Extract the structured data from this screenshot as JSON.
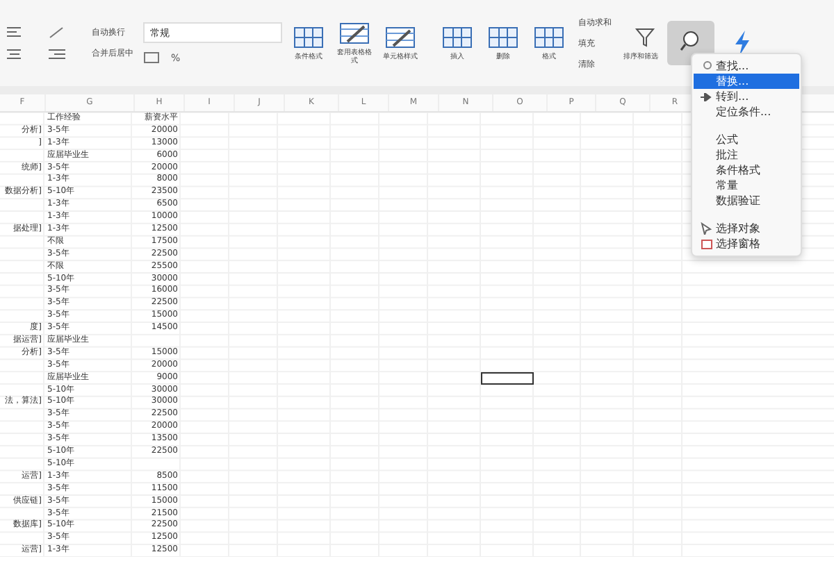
{
  "ribbon": {
    "wrap_text": "自动换行",
    "merge_center": "合并后居中",
    "number_format": "常规",
    "percent": "%",
    "groups": [
      {
        "label": "条件格式",
        "kind": "grid"
      },
      {
        "label": "套用表格格式",
        "kind": "table"
      },
      {
        "label": "单元格样式",
        "kind": "table"
      },
      {
        "label": "插入",
        "kind": "grid"
      },
      {
        "label": "删除",
        "kind": "grid"
      },
      {
        "label": "格式",
        "kind": "grid"
      }
    ],
    "editing": [
      "自动求和",
      "填充",
      "清除"
    ],
    "sort_filter": "排序和筛选"
  },
  "sheet": {
    "columns": [
      "F",
      "G",
      "H",
      "I",
      "J",
      "K",
      "L",
      "M",
      "N",
      "O",
      "P",
      "Q",
      "R"
    ],
    "header": [
      "工作经验",
      "薪资水平"
    ],
    "rows": [
      [
        "分析]",
        "3-5年",
        "20000"
      ],
      [
        "]",
        "1-3年",
        "13000"
      ],
      [
        "",
        "应届毕业生",
        "6000"
      ],
      [
        "统师]",
        "3-5年",
        "20000"
      ],
      [
        "",
        "1-3年",
        "8000"
      ],
      [
        "数据分析]",
        "5-10年",
        "23500"
      ],
      [
        "",
        "1-3年",
        "6500"
      ],
      [
        "",
        "1-3年",
        "10000"
      ],
      [
        "据处理]",
        "1-3年",
        "12500"
      ],
      [
        "",
        "不限",
        "17500"
      ],
      [
        "",
        "3-5年",
        "22500"
      ],
      [
        "",
        "不限",
        "25500"
      ],
      [
        "",
        "5-10年",
        "30000"
      ],
      [
        "",
        "3-5年",
        "16000"
      ],
      [
        "",
        "3-5年",
        "22500"
      ],
      [
        "",
        "3-5年",
        "15000"
      ],
      [
        "度]",
        "3-5年",
        "14500"
      ],
      [
        "据运营]",
        "应届毕业生",
        ""
      ],
      [
        "分析]",
        "3-5年",
        "15000"
      ],
      [
        "",
        "3-5年",
        "20000"
      ],
      [
        "",
        "应届毕业生",
        "9000"
      ],
      [
        "",
        "5-10年",
        "30000"
      ],
      [
        "法，算法]",
        "5-10年",
        "30000"
      ],
      [
        "",
        "3-5年",
        "22500"
      ],
      [
        "",
        "3-5年",
        "20000"
      ],
      [
        "",
        "3-5年",
        "13500"
      ],
      [
        "",
        "5-10年",
        "22500"
      ],
      [
        "",
        "5-10年",
        ""
      ],
      [
        "运营]",
        "1-3年",
        "8500"
      ],
      [
        "",
        "3-5年",
        "11500"
      ],
      [
        "供应链]",
        "3-5年",
        "15000"
      ],
      [
        "",
        "3-5年",
        "21500"
      ],
      [
        "数据库]",
        "5-10年",
        "22500"
      ],
      [
        "",
        "3-5年",
        "12500"
      ],
      [
        "运营]",
        "1-3年",
        "12500"
      ]
    ]
  },
  "menu": {
    "items": [
      {
        "label": "查找...",
        "kind": "item",
        "selected": false
      },
      {
        "label": "替换...",
        "kind": "item",
        "selected": true
      },
      {
        "label": "转到...",
        "kind": "item",
        "selected": false
      },
      {
        "label": "定位条件...",
        "kind": "item",
        "selected": false
      },
      {
        "kind": "separator"
      },
      {
        "label": "公式",
        "kind": "item",
        "selected": false
      },
      {
        "label": "批注",
        "kind": "item",
        "selected": false
      },
      {
        "label": "条件格式",
        "kind": "item",
        "selected": false
      },
      {
        "label": "常量",
        "kind": "item",
        "selected": false
      },
      {
        "label": "数据验证",
        "kind": "item",
        "selected": false
      },
      {
        "kind": "separator"
      },
      {
        "label": "选择对象",
        "kind": "item",
        "selected": false
      },
      {
        "label": "选择窗格",
        "kind": "item",
        "selected": false
      }
    ]
  }
}
